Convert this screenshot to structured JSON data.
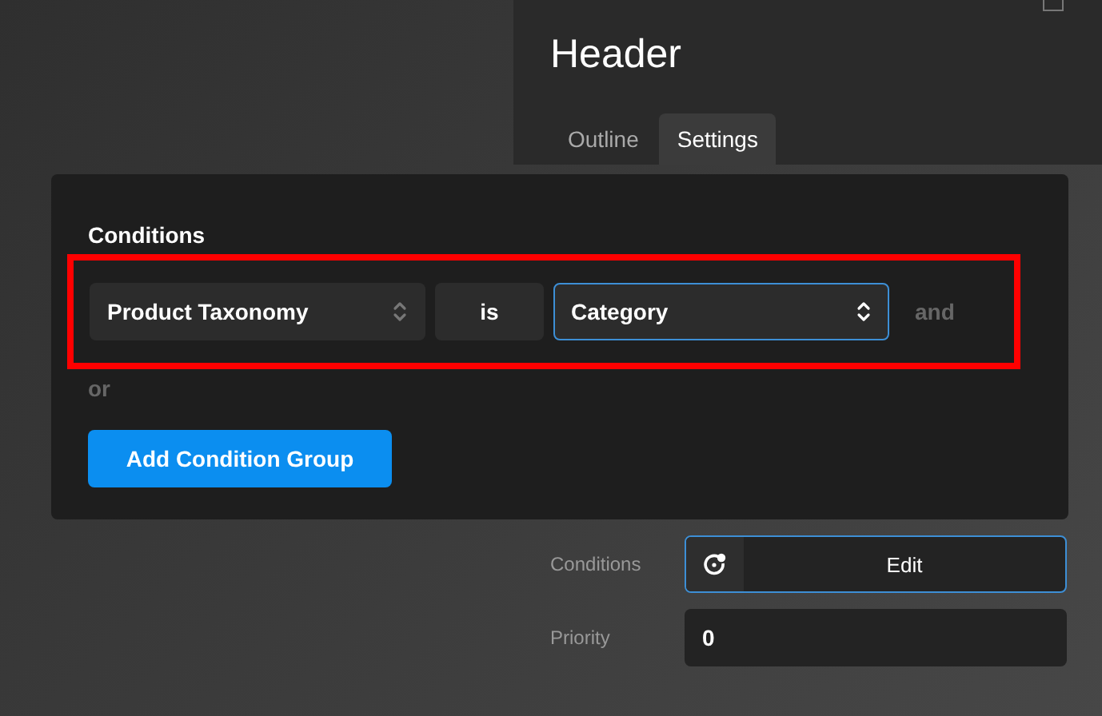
{
  "panel": {
    "title": "Header",
    "tabs": [
      {
        "label": "Outline",
        "selected": false
      },
      {
        "label": "Settings",
        "selected": true
      }
    ]
  },
  "conditions_popup": {
    "heading": "Conditions",
    "row": [
      {
        "kind": "select",
        "value": "Product Taxonomy",
        "focused": false
      },
      {
        "kind": "operator",
        "value": "is"
      },
      {
        "kind": "select",
        "value": "Category",
        "focused": true
      }
    ],
    "and_label": "and",
    "or_label": "or",
    "add_button": "Add Condition Group"
  },
  "settings": [
    {
      "label": "Conditions",
      "kind": "edit",
      "value": "Edit",
      "focused": true
    },
    {
      "label": "Priority",
      "kind": "number",
      "value": "0",
      "focused": false
    }
  ]
}
